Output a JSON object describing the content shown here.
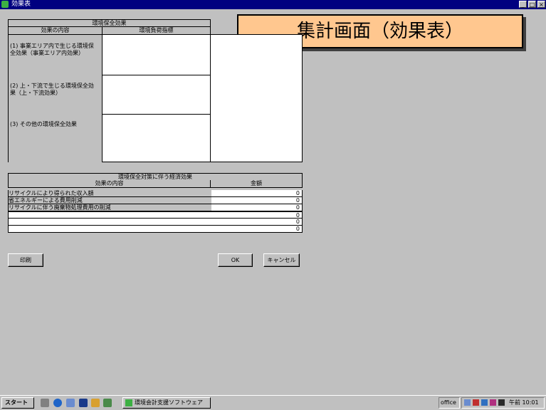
{
  "window": {
    "title": "効果表"
  },
  "banner": {
    "text": "集計画面（効果表）"
  },
  "env_effects": {
    "section_title": "環境保全効果",
    "col_content": "効果の内容",
    "col_indicator": "環境負荷指標",
    "rows": [
      {
        "label": "(1) 事業エリア内で生じる環境保全効果（事業エリア内効果）"
      },
      {
        "label": "(2) 上・下流で生じる環境保全効果（上・下流効果）"
      },
      {
        "label": "(3) その他の環境保全効果"
      }
    ]
  },
  "economic": {
    "section_title": "環境保全対策に伴う経済効果",
    "col_content": "効果の内容",
    "col_amount": "金額",
    "rows": [
      {
        "name": "リサイクルにより得られた収入額",
        "value": "0"
      },
      {
        "name": "省エネルギーによる費用削減",
        "value": "0"
      },
      {
        "name": "リサイクルに伴う廃棄物処理費用の削減",
        "value": "0"
      },
      {
        "name": "",
        "value": "0"
      },
      {
        "name": "",
        "value": "0"
      },
      {
        "name": "",
        "value": "0"
      }
    ]
  },
  "buttons": {
    "print": "印刷",
    "ok": "OK",
    "cancel": "キャンセル"
  },
  "taskbar": {
    "start": "スタート",
    "task": "環境会計支援ソフトウェア",
    "tray_office": "office",
    "clock": "午前 10:01"
  }
}
